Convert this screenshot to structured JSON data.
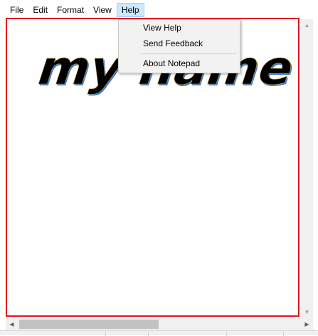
{
  "menubar": {
    "items": [
      {
        "label": "File"
      },
      {
        "label": "Edit"
      },
      {
        "label": "Format"
      },
      {
        "label": "View"
      },
      {
        "label": "Help",
        "open": true
      }
    ]
  },
  "help_menu": {
    "items": [
      "View Help",
      "Send Feedback",
      "About Notepad"
    ]
  },
  "document": {
    "word_art_text": "my name"
  },
  "colors": {
    "highlight_border": "#e3141c",
    "menu_open_bg": "#cce8ff"
  }
}
